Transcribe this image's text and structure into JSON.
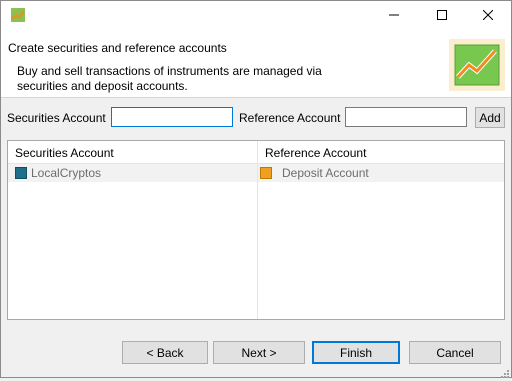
{
  "titlebar": {
    "icons": {
      "app": "app-chart-icon",
      "minimize": "minimize-icon",
      "maximize": "maximize-icon",
      "close": "close-icon"
    }
  },
  "header": {
    "title": "Create securities and reference accounts",
    "description": "Buy and sell transactions of instruments are managed via securities and deposit accounts.",
    "logo_icon": "wizard-chart-icon"
  },
  "form": {
    "securities_label": "Securities Account",
    "securities_value": "",
    "reference_label": "Reference Account",
    "reference_value": "",
    "add_label": "Add"
  },
  "tables": {
    "securities": {
      "header": "Securities Account",
      "rows": [
        {
          "label": "LocalCryptos",
          "icon": "securities-account-icon",
          "color": "#1f6f8b"
        }
      ]
    },
    "reference": {
      "header": "Reference Account",
      "rows": [
        {
          "label": "Deposit Account",
          "icon": "deposit-account-icon",
          "color": "#f0a020"
        }
      ]
    }
  },
  "buttons": {
    "back": "< Back",
    "next": "Next >",
    "finish": "Finish",
    "cancel": "Cancel"
  },
  "colors": {
    "accent": "#0078d7",
    "chart_green": "#78c850",
    "chart_orange": "#f28c1e"
  }
}
